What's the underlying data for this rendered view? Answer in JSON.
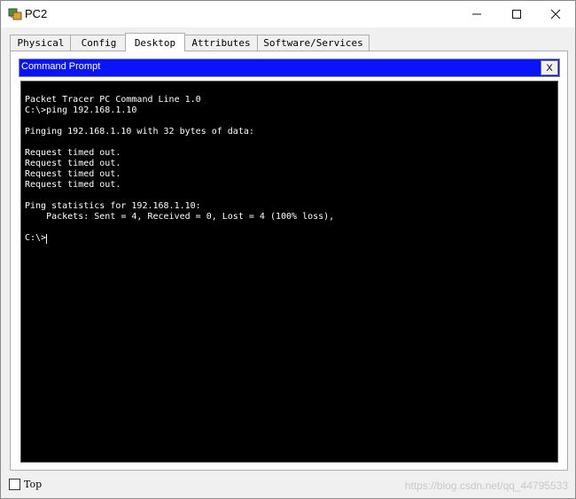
{
  "window": {
    "title": "PC2"
  },
  "tabs": [
    {
      "label": "Physical"
    },
    {
      "label": "Config"
    },
    {
      "label": "Desktop",
      "active": true
    },
    {
      "label": "Attributes"
    },
    {
      "label": "Software/Services"
    }
  ],
  "command_prompt": {
    "title": "Command Prompt",
    "close_label": "X",
    "lines": [
      "Packet Tracer PC Command Line 1.0",
      "C:\\>ping 192.168.1.10",
      "",
      "Pinging 192.168.1.10 with 32 bytes of data:",
      "",
      "Request timed out.",
      "Request timed out.",
      "Request timed out.",
      "Request timed out.",
      "",
      "Ping statistics for 192.168.1.10:",
      "    Packets: Sent = 4, Received = 0, Lost = 4 (100% loss),",
      "",
      "C:\\>"
    ]
  },
  "footer": {
    "checkbox_label": "Top",
    "checked": false
  },
  "watermark": "https://blog.csdn.net/qq_44795533",
  "colors": {
    "terminal_bg": "#000000",
    "header_bg": "#0a14fa"
  }
}
